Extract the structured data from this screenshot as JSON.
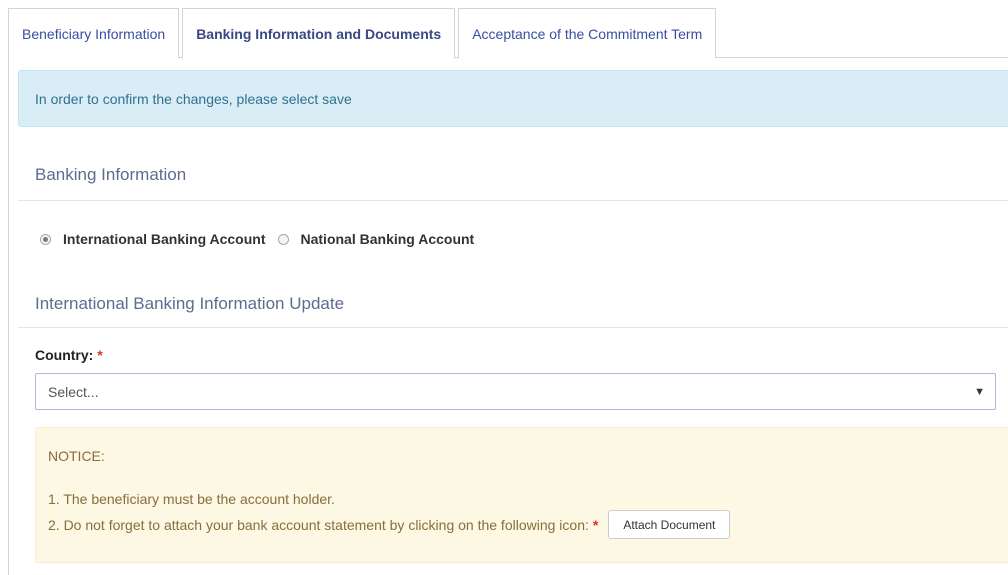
{
  "tabs": [
    {
      "label": "Beneficiary Information",
      "active": false
    },
    {
      "label": "Banking Information and Documents",
      "active": true
    },
    {
      "label": "Acceptance of the Commitment Term",
      "active": false
    }
  ],
  "info_alert": "In order to confirm the changes, please select save",
  "banking_section": {
    "title": "Banking Information",
    "options": [
      {
        "label": "International Banking Account",
        "selected": true
      },
      {
        "label": "National Banking Account",
        "selected": false
      }
    ]
  },
  "international_section": {
    "title": "International Banking Information Update",
    "country_label": "Country:",
    "required_mark": "*",
    "country_select_value": "Select..."
  },
  "notice": {
    "title": "NOTICE:",
    "line1": "1. The beneficiary must be the account holder.",
    "line2": "2. Do not forget to attach your bank account statement by clicking on the following icon:",
    "required_mark": "*",
    "attach_button": "Attach Document"
  },
  "colors": {
    "tab_text": "#3a4ea1",
    "info_bg": "#d9edf7",
    "warning_bg": "#fcf8e3",
    "required": "#d9342b"
  }
}
